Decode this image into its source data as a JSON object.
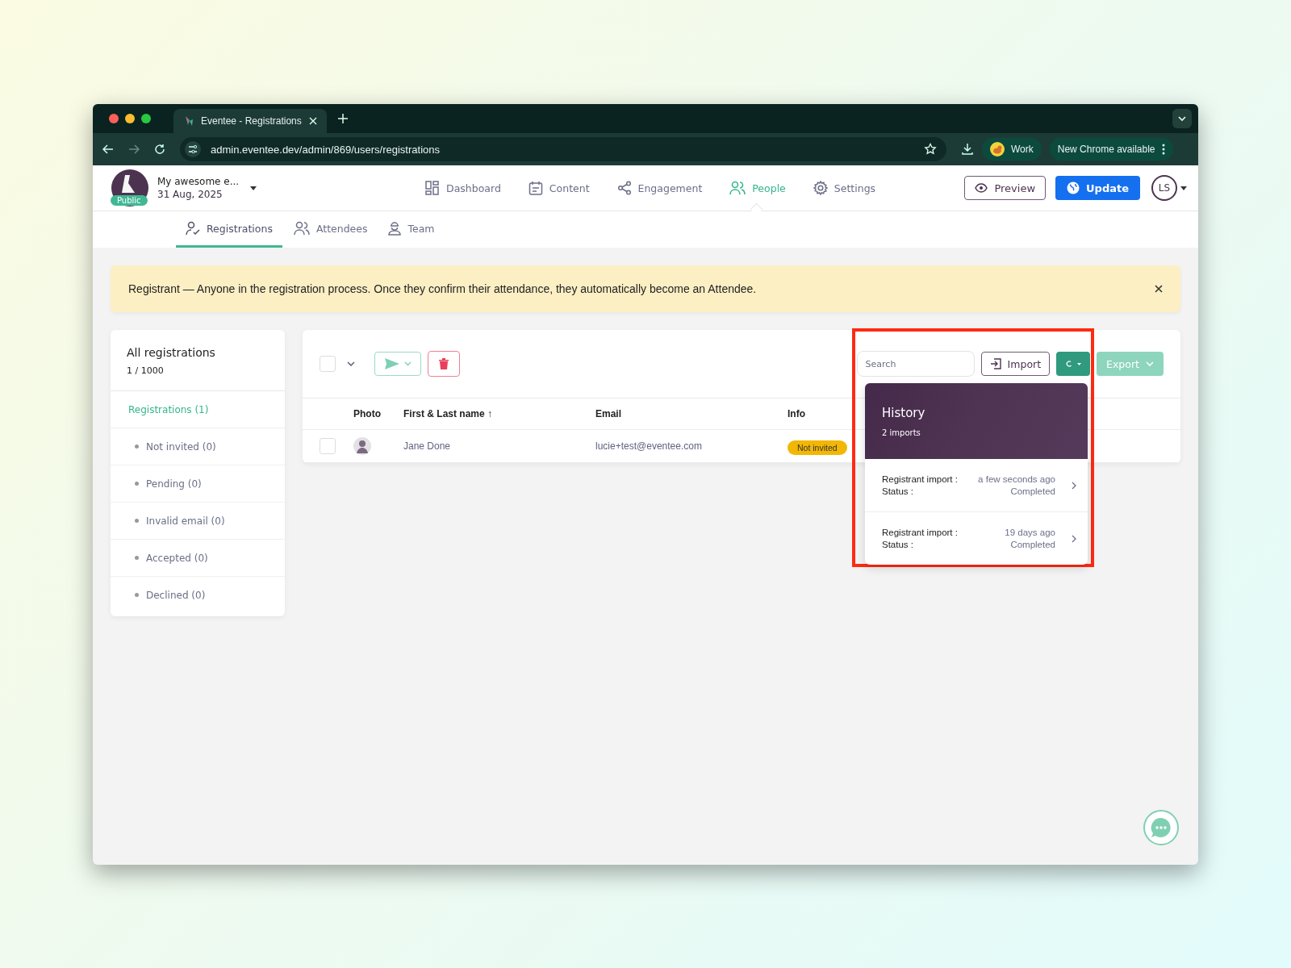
{
  "browser": {
    "tab_title": "Eventee - Registrations",
    "url": "admin.eventee.dev/admin/869/users/registrations",
    "profile": "Work",
    "update_notice": "New Chrome available"
  },
  "event": {
    "name": "My awesome e...",
    "date": "31 Aug, 2025",
    "badge": "Public"
  },
  "nav": [
    {
      "label": "Dashboard",
      "selected": false
    },
    {
      "label": "Content",
      "selected": false
    },
    {
      "label": "Engagement",
      "selected": false
    },
    {
      "label": "People",
      "selected": true
    },
    {
      "label": "Settings",
      "selected": false
    }
  ],
  "header_buttons": {
    "preview": "Preview",
    "update": "Update",
    "avatar": "LS"
  },
  "subtabs": [
    {
      "label": "Registrations",
      "selected": true
    },
    {
      "label": "Attendees",
      "selected": false
    },
    {
      "label": "Team",
      "selected": false
    }
  ],
  "banner": {
    "text": "Registrant — Anyone in the registration process. Once they confirm their attendance, they automatically become an Attendee."
  },
  "sidebar": {
    "title": "All registrations",
    "count": "1 / 1000",
    "items": [
      {
        "label": "Registrations (1)",
        "selected": true,
        "children": [
          {
            "label": "Not invited (0)",
            "selected": false
          },
          {
            "label": "Pending (0)",
            "selected": false
          },
          {
            "label": "Invalid email (0)",
            "selected": false
          },
          {
            "label": "Accepted (0)",
            "selected": false
          },
          {
            "label": "Declined (0)",
            "selected": false
          }
        ]
      }
    ]
  },
  "toolbar": {
    "select_all_checked": false,
    "search_placeholder": "Search",
    "import": "Import",
    "export": "Export"
  },
  "table": {
    "columns": [
      "Photo",
      "First & Last name ↑",
      "Email",
      "Info"
    ],
    "rows": [
      {
        "checked": false,
        "name": "Jane Done",
        "email": "lucie+test@eventee.com",
        "info": {
          "label": "Not invited",
          "color": "#f2b705"
        }
      }
    ]
  },
  "history": {
    "title": "History",
    "subtitle": "2 imports",
    "entries": [
      {
        "label": "Registrant import :",
        "time": "a few seconds ago",
        "status_label": "Status :",
        "status": "Completed"
      },
      {
        "label": "Registrant import :",
        "time": "19 days ago",
        "status_label": "Status :",
        "status": "Completed"
      }
    ]
  }
}
